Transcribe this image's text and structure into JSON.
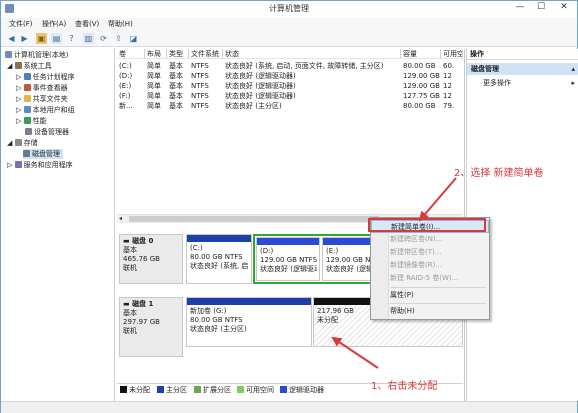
{
  "window": {
    "title": "计算机管理",
    "minimize": "—",
    "maximize": "☐",
    "close": "✕"
  },
  "menu": [
    "文件(F)",
    "操作(A)",
    "查看(V)",
    "帮助(H)"
  ],
  "tree": {
    "root": "计算机管理(本地)",
    "system_tools": "系统工具",
    "task_scheduler": "任务计划程序",
    "event_viewer": "事件查看器",
    "shared_folders": "共享文件夹",
    "local_users": "本地用户和组",
    "performance": "性能",
    "device_manager": "设备管理器",
    "storage": "存储",
    "disk_management": "磁盘管理",
    "services": "服务和应用程序"
  },
  "volume_table": {
    "columns": [
      "卷",
      "布局",
      "类型",
      "文件系统",
      "状态",
      "容量",
      "可用空间"
    ],
    "rows": [
      [
        "(C:)",
        "简单",
        "基本",
        "NTFS",
        "状态良好 (系统, 启动, 页面文件, 故障转储, 主分区)",
        "80.00 GB",
        "60."
      ],
      [
        "(D:)",
        "简单",
        "基本",
        "NTFS",
        "状态良好 (逻辑驱动器)",
        "129.00 GB",
        "12"
      ],
      [
        "(E:)",
        "简单",
        "基本",
        "NTFS",
        "状态良好 (逻辑驱动器)",
        "129.00 GB",
        "12"
      ],
      [
        "(F:)",
        "简单",
        "基本",
        "NTFS",
        "状态良好 (逻辑驱动器)",
        "127.75 GB",
        "12"
      ],
      [
        "新...",
        "简单",
        "基本",
        "NTFS",
        "状态良好 (主分区)",
        "80.00 GB",
        "79."
      ]
    ]
  },
  "disks": [
    {
      "name": "磁盘 0",
      "kind": "基本",
      "size": "465.76 GB",
      "status": "联机",
      "partitions": [
        {
          "title": "(C:)",
          "line2": "80.00 GB NTFS",
          "line3": "状态良好 (系统, 启"
        },
        {
          "title": "(D:)",
          "line2": "129.00 GB NTFS",
          "line3": "状态良好 (逻辑驱动"
        },
        {
          "title": "(E:)",
          "line2": "129.00 GB NTFS",
          "line3": "状态良好 (逻辑驱动"
        }
      ]
    },
    {
      "name": "磁盘 1",
      "kind": "基本",
      "size": "297.97 GB",
      "status": "联机",
      "partitions": [
        {
          "title": "新加卷 (G:)",
          "line2": "80.00 GB NTFS",
          "line3": "状态良好 (主分区)"
        },
        {
          "title": "",
          "line2": "217.96 GB",
          "line3": "未分配"
        }
      ]
    }
  ],
  "legend": [
    "未分配",
    "主分区",
    "扩展分区",
    "可用空间",
    "逻辑驱动器"
  ],
  "colors": {
    "unallocated": "#111111",
    "primary": "#1c3fa8",
    "extended": "#6aa84f",
    "free": "#7ccf5a",
    "logical": "#2a4bd7",
    "annotation": "#d83a3a",
    "green_frame": "#2faa2f",
    "highlight": "#cfe3f7"
  },
  "actions": {
    "header": "操作",
    "section": "磁盘管理",
    "more": "更多操作"
  },
  "context_menu": [
    {
      "label": "新建简单卷(I)...",
      "enabled": true
    },
    {
      "label": "新建跨区卷(N)...",
      "enabled": false
    },
    {
      "label": "新建带区卷(T)...",
      "enabled": false
    },
    {
      "label": "新建镜像卷(R)...",
      "enabled": false
    },
    {
      "label": "新建 RAID-5 卷(W)...",
      "enabled": false
    },
    {
      "label": "属性(P)",
      "enabled": true
    },
    {
      "label": "帮助(H)",
      "enabled": true
    }
  ],
  "annotations": {
    "step2": "2、选择 新建简单卷",
    "step1": "1、右击未分配"
  }
}
